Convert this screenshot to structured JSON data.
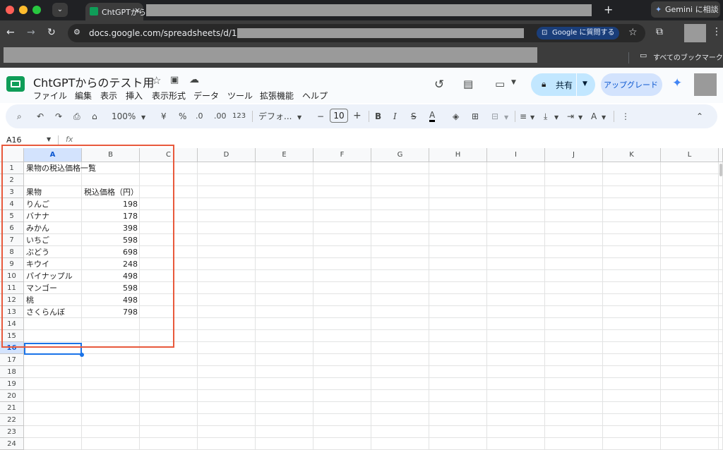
{
  "browser": {
    "tab_title": "ChtGPTから",
    "gemini_label": "Gemini に相談",
    "url": "docs.google.com/spreadsheets/d/1LRM",
    "ask_google_label": "Google に質問する",
    "bookmarks_label": "すべてのブックマーク"
  },
  "doc": {
    "title": "ChtGPTからのテスト用",
    "menus": [
      "ファイル",
      "編集",
      "表示",
      "挿入",
      "表示形式",
      "データ",
      "ツール",
      "拡張機能",
      "ヘルプ"
    ],
    "share_label": "共有",
    "upgrade_label": "アップグレード"
  },
  "toolbar": {
    "zoom": "100%",
    "currency": "¥",
    "percent": "%",
    "dec_minus": ".0",
    "dec_plus": ".00",
    "number_format": "123",
    "font": "デフォ...",
    "font_size": "10",
    "bold": "B",
    "italic": "I",
    "strike": "S",
    "text_color": "A"
  },
  "formula_bar": {
    "cell_ref": "A16",
    "fx": "fx"
  },
  "grid": {
    "columns": [
      "A",
      "B",
      "C",
      "D",
      "E",
      "F",
      "G",
      "H",
      "I",
      "J",
      "K",
      "L"
    ],
    "rows": [
      "1",
      "2",
      "3",
      "4",
      "5",
      "6",
      "7",
      "8",
      "9",
      "10",
      "11",
      "12",
      "13",
      "14",
      "15",
      "16",
      "17",
      "18",
      "19",
      "20",
      "21",
      "22",
      "23",
      "24"
    ],
    "cells": {
      "a1": "果物の税込価格一覧",
      "a3": "果物",
      "b3": "税込価格（円）",
      "a4": "りんご",
      "b4": "198",
      "a5": "バナナ",
      "b5": "178",
      "a6": "みかん",
      "b6": "398",
      "a7": "いちご",
      "b7": "598",
      "a8": "ぶどう",
      "b8": "698",
      "a9": "キウイ",
      "b9": "248",
      "a10": "パイナップル",
      "b10": "498",
      "a11": "マンゴー",
      "b11": "598",
      "a12": "桃",
      "b12": "498",
      "a13": "さくらんぼ",
      "b13": "798"
    }
  },
  "colors": {
    "highlight_box": "#e8593c",
    "selection": "#1a73e8",
    "share_bg": "#c2e7ff"
  }
}
